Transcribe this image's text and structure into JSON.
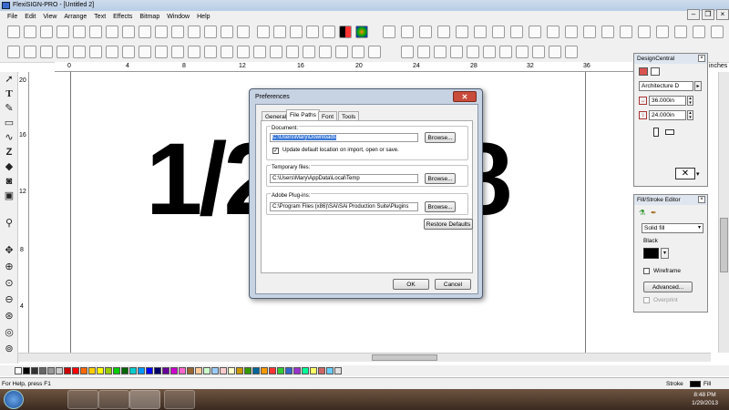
{
  "window": {
    "title": "FlexiSIGN-PRO - [Untitled 2]"
  },
  "menu": [
    "File",
    "Edit",
    "View",
    "Arrange",
    "Text",
    "Effects",
    "Bitmap",
    "Window",
    "Help"
  ],
  "ruler": {
    "top_ticks": [
      "0",
      "4",
      "8",
      "12",
      "16",
      "20",
      "24",
      "28",
      "32",
      "36"
    ],
    "left_ticks": [
      "20",
      "16",
      "12",
      "8",
      "4"
    ],
    "units": "inches"
  },
  "canvas": {
    "text_left": "1/2",
    "text_right": "8"
  },
  "dialog": {
    "title": "Preferences",
    "close": "✕",
    "tabs": [
      "General",
      "File Paths",
      "Font",
      "Tools"
    ],
    "active_tab": "File Paths",
    "document": {
      "label": "Document:",
      "value": "C:\\Users\\Mary\\Downloads",
      "browse": "Browse...",
      "checkbox_label": "Update default location on import, open or save.",
      "checkbox_checked": true
    },
    "temp": {
      "label": "Temporary files:",
      "value": "C:\\Users\\Mary\\AppData\\Local\\Temp",
      "browse": "Browse..."
    },
    "plugins": {
      "label": "Adobe Plug-ins:",
      "value": "C:\\Program Files (x86)\\SAi\\SAi Production Suite\\Plugins",
      "browse": "Browse..."
    },
    "restore": "Restore Defaults",
    "ok": "OK",
    "cancel": "Cancel"
  },
  "design_central": {
    "title": "DesignCentral",
    "preset": "Architecture D",
    "width": "36.000in",
    "height": "24.000in"
  },
  "fill_stroke": {
    "title": "Fill/Stroke Editor",
    "fill_type": "Solid fill",
    "color_name": "Black",
    "wireframe_label": "Wireframe",
    "advanced": "Advanced...",
    "overprint_label": "Overprint"
  },
  "status": {
    "help": "For Help, press F1",
    "stroke": "Stroke",
    "fill": "Fill"
  },
  "taskbar": {
    "time": "8:48 PM",
    "date": "1/29/2013"
  },
  "colors": {
    "accent": "#3b78d6",
    "dialog_frame": "#c7d3e3",
    "close_red": "#c94c3a"
  }
}
